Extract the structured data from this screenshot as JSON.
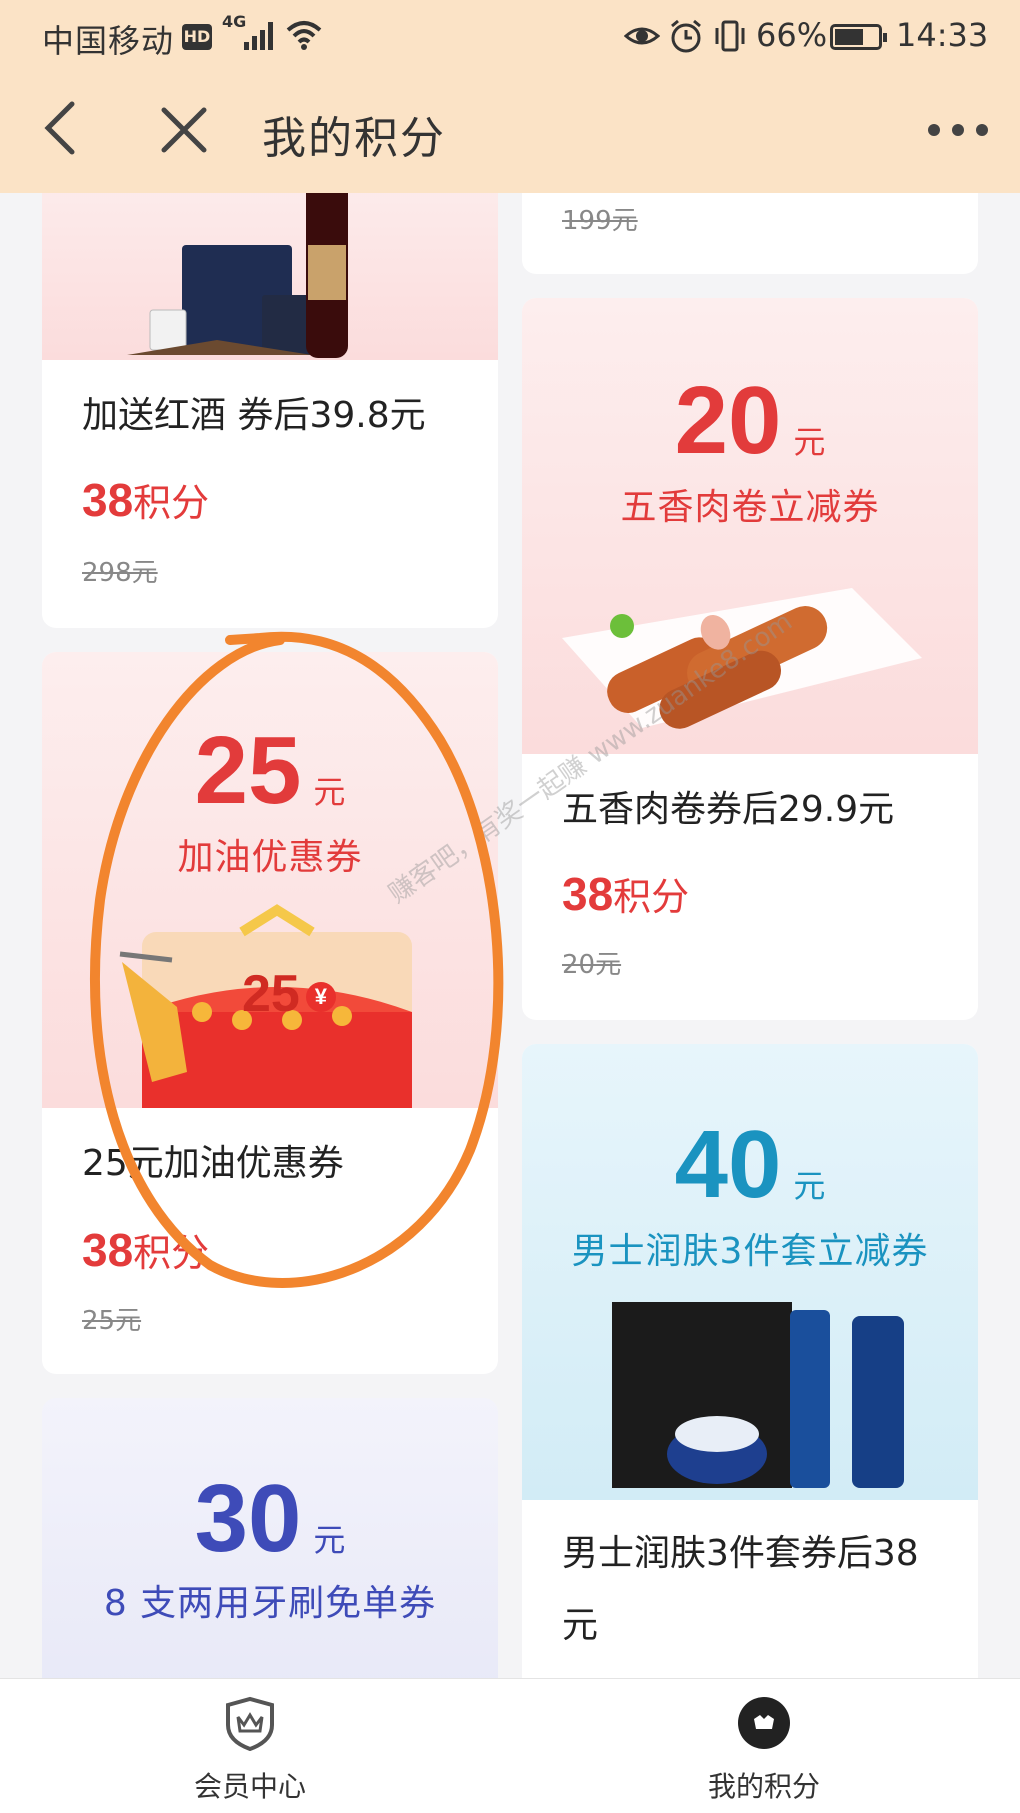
{
  "status_bar": {
    "carrier": "中国移动",
    "hd": "HD",
    "network": "4G",
    "battery_pct": "66%",
    "battery_level": 0.66,
    "time": "14:33"
  },
  "header": {
    "title": "我的积分"
  },
  "cards": {
    "wine": {
      "title": "加送红酒 券后39.8元",
      "points_num": "38",
      "points_label": "积分",
      "original": "298元"
    },
    "top_right": {
      "original": "199元"
    },
    "meat": {
      "amount": "20",
      "unit": "元",
      "subtitle": "五香肉卷立减券",
      "title": "五香肉卷券后29.9元",
      "points_num": "38",
      "points_label": "积分",
      "original": "20元"
    },
    "fuel": {
      "amount": "25",
      "unit": "元",
      "subtitle": "加油优惠券",
      "envelope_amount": "25",
      "envelope_currency": "¥",
      "title": "25元加油优惠券",
      "points_num": "38",
      "points_label": "积分",
      "original": "25元"
    },
    "mens": {
      "amount": "40",
      "unit": "元",
      "subtitle": "男士润肤3件套立减券",
      "title_line1": "男士润肤3件套券后38",
      "title_line2": "元"
    },
    "toothbrush": {
      "amount": "30",
      "unit": "元",
      "subtitle": "8 支两用牙刷免单券"
    }
  },
  "watermark": "赚客吧，有奖一起赚 www.zuanke8.com",
  "bottom_nav": {
    "member_center": "会员中心",
    "my_points": "我的积分"
  },
  "colors": {
    "header_bg": "#fbe3c6",
    "price_red": "#e23b3b",
    "teal": "#1a93c0",
    "indigo": "#3e4bb8",
    "annotation_orange": "#f2852e"
  }
}
